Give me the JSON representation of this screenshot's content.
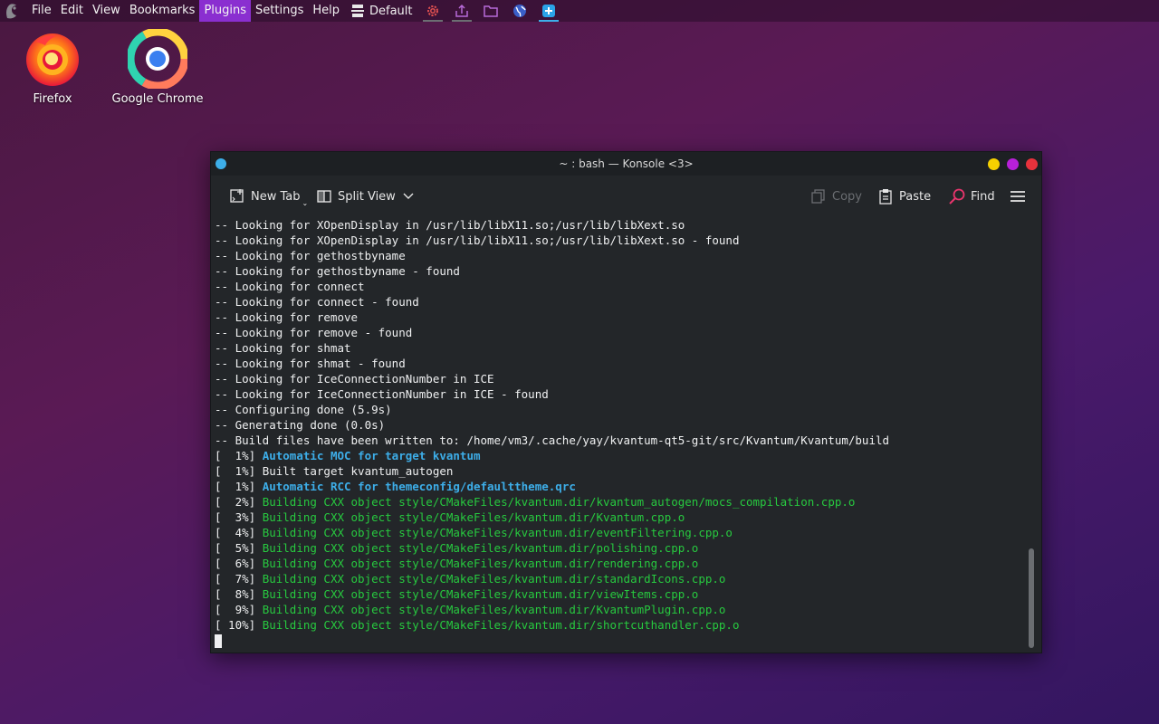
{
  "topbar": {
    "menus": [
      "File",
      "Edit",
      "View",
      "Bookmarks",
      "Plugins",
      "Settings",
      "Help"
    ],
    "active_menu": "Plugins",
    "layout_label": "Default",
    "icons": [
      "gear-icon",
      "upload-icon",
      "folder-icon",
      "globe-icon",
      "add-note-icon"
    ]
  },
  "desktop": {
    "icons": [
      {
        "label": "Firefox",
        "icon": "firefox-icon"
      },
      {
        "label": "Google Chrome",
        "icon": "chrome-icon"
      }
    ]
  },
  "window": {
    "title": "~ : bash — Konsole <3>",
    "toolbar": {
      "new_tab": "New Tab",
      "split_view": "Split View",
      "copy": "Copy",
      "paste": "Paste",
      "find": "Find"
    }
  },
  "terminal": {
    "lines": [
      {
        "prefix": "",
        "text": "-- Looking for XOpenDisplay in /usr/lib/libX11.so;/usr/lib/libXext.so",
        "style": "plain"
      },
      {
        "prefix": "",
        "text": "-- Looking for XOpenDisplay in /usr/lib/libX11.so;/usr/lib/libXext.so - found",
        "style": "plain"
      },
      {
        "prefix": "",
        "text": "-- Looking for gethostbyname",
        "style": "plain"
      },
      {
        "prefix": "",
        "text": "-- Looking for gethostbyname - found",
        "style": "plain"
      },
      {
        "prefix": "",
        "text": "-- Looking for connect",
        "style": "plain"
      },
      {
        "prefix": "",
        "text": "-- Looking for connect - found",
        "style": "plain"
      },
      {
        "prefix": "",
        "text": "-- Looking for remove",
        "style": "plain"
      },
      {
        "prefix": "",
        "text": "-- Looking for remove - found",
        "style": "plain"
      },
      {
        "prefix": "",
        "text": "-- Looking for shmat",
        "style": "plain"
      },
      {
        "prefix": "",
        "text": "-- Looking for shmat - found",
        "style": "plain"
      },
      {
        "prefix": "",
        "text": "-- Looking for IceConnectionNumber in ICE",
        "style": "plain"
      },
      {
        "prefix": "",
        "text": "-- Looking for IceConnectionNumber in ICE - found",
        "style": "plain"
      },
      {
        "prefix": "",
        "text": "-- Configuring done (5.9s)",
        "style": "plain"
      },
      {
        "prefix": "",
        "text": "-- Generating done (0.0s)",
        "style": "plain"
      },
      {
        "prefix": "",
        "text": "-- Build files have been written to: /home/vm3/.cache/yay/kvantum-qt5-git/src/Kvantum/Kvantum/build",
        "style": "plain"
      },
      {
        "prefix": "[  1%] ",
        "text": "Automatic MOC for target kvantum",
        "style": "blue"
      },
      {
        "prefix": "[  1%] ",
        "text": "Built target kvantum_autogen",
        "style": "plain"
      },
      {
        "prefix": "[  1%] ",
        "text": "Automatic RCC for themeconfig/defaulttheme.qrc",
        "style": "blue"
      },
      {
        "prefix": "[  2%] ",
        "text": "Building CXX object style/CMakeFiles/kvantum.dir/kvantum_autogen/mocs_compilation.cpp.o",
        "style": "green"
      },
      {
        "prefix": "[  3%] ",
        "text": "Building CXX object style/CMakeFiles/kvantum.dir/Kvantum.cpp.o",
        "style": "green"
      },
      {
        "prefix": "[  4%] ",
        "text": "Building CXX object style/CMakeFiles/kvantum.dir/eventFiltering.cpp.o",
        "style": "green"
      },
      {
        "prefix": "[  5%] ",
        "text": "Building CXX object style/CMakeFiles/kvantum.dir/polishing.cpp.o",
        "style": "green"
      },
      {
        "prefix": "[  6%] ",
        "text": "Building CXX object style/CMakeFiles/kvantum.dir/rendering.cpp.o",
        "style": "green"
      },
      {
        "prefix": "[  7%] ",
        "text": "Building CXX object style/CMakeFiles/kvantum.dir/standardIcons.cpp.o",
        "style": "green"
      },
      {
        "prefix": "[  8%] ",
        "text": "Building CXX object style/CMakeFiles/kvantum.dir/viewItems.cpp.o",
        "style": "green"
      },
      {
        "prefix": "[  9%] ",
        "text": "Building CXX object style/CMakeFiles/kvantum.dir/KvantumPlugin.cpp.o",
        "style": "green"
      },
      {
        "prefix": "[ 10%] ",
        "text": "Building CXX object style/CMakeFiles/kvantum.dir/shortcuthandler.cpp.o",
        "style": "green"
      }
    ]
  },
  "colors": {
    "accent": "#3daee9",
    "menu_highlight": "#8a2fd0",
    "terminal_bg": "#232629",
    "terminal_fg": "#eff0f1",
    "build_green": "#27c93f",
    "btn_minimize": "#f5d000",
    "btn_maximize": "#b820d8",
    "btn_close": "#e8323c"
  }
}
